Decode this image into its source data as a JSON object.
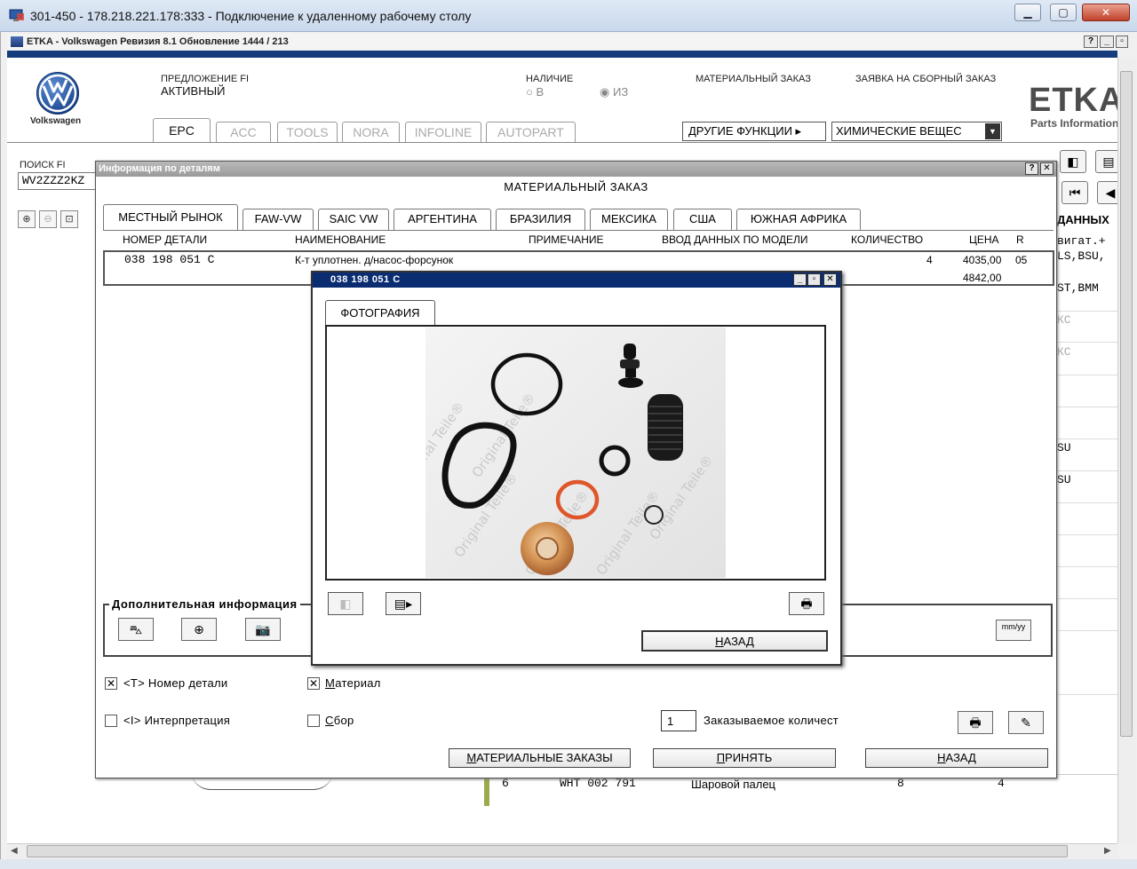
{
  "rdp": {
    "title": "301-450 - 178.218.221.178:333 - Подключение к удаленному рабочему столу"
  },
  "app": {
    "title": "ETKA - Volkswagen Ревизия 8.1 Обновление 1444 / 213",
    "brand_logo_label": "Volkswagen",
    "brand_name": "ETKA",
    "brand_subtitle": "Parts Information"
  },
  "header": {
    "offer_label": "ПРЕДЛОЖЕНИЕ FI",
    "offer_status": "АКТИВНЫЙ",
    "availability_label": "НАЛИЧИЕ",
    "radio_in": "В",
    "radio_from": "ИЗ",
    "material_order_link": "МАТЕРИАЛЬНЫЙ ЗАКАЗ",
    "collective_order_link": "ЗАЯВКА НА СБОРНЫЙ ЗАКАЗ",
    "other_functions": "ДРУГИЕ ФУНКЦИИ",
    "chem_select": "ХИМИЧЕСКИЕ ВЕЩЕС"
  },
  "app_tabs": [
    "EPC",
    "ACC",
    "TOOLS",
    "NORA",
    "INFOLINE",
    "AUTOPART"
  ],
  "search": {
    "label": "ПОИСК FI",
    "value": "WV2ZZZ2KZ"
  },
  "right_column": {
    "header": "ДАННЫХ",
    "rows": [
      "вигат.+",
      "LS,BSU,",
      "ST,BMM",
      "КС",
      "КС",
      "SU",
      "SU"
    ]
  },
  "background_row": {
    "pos": "6",
    "part": "WHT 002 791",
    "name": "Шаровой палец",
    "c1": "8",
    "c2": "4"
  },
  "dialog_info": {
    "title": "Информация по деталям",
    "heading": "МАТЕРИАЛЬНЫЙ ЗАКАЗ",
    "market_tabs": [
      "МЕСТНЫЙ РЫНОК",
      "FAW-VW",
      "SAIC VW",
      "АРГЕНТИНА",
      "БРАЗИЛИЯ",
      "МЕКСИКА",
      "США",
      "ЮЖНАЯ АФРИКА"
    ],
    "columns": {
      "part_number": "НОМЕР ДЕТАЛИ",
      "name": "НАИМЕНОВАНИЕ",
      "note": "ПРИМЕЧАНИЕ",
      "model_input": "ВВОД ДАННЫХ ПО МОДЕЛИ",
      "quantity": "КОЛИЧЕСТВО",
      "price": "ЦЕНА",
      "r": "R"
    },
    "row": {
      "part_number": "038 198 051 C",
      "name": "К-т уплотнен. д/насос-форсунок",
      "quantity": "4",
      "price": "4035,00",
      "price2": "4842,00",
      "r": "05"
    },
    "additional_info_label": "Дополнительная информация",
    "checkboxes": {
      "part_number": {
        "label": "<T> Номер детали",
        "checked": true
      },
      "interpretation": {
        "label": "<I> Интерпретация",
        "checked": false
      },
      "material": {
        "label": "Материал",
        "checked": true
      },
      "assembly": {
        "label": "Сбор",
        "checked": false
      }
    },
    "order_qty_value": "1",
    "order_qty_label": "Заказываемое количест",
    "date_button": "mm/yy",
    "buttons": {
      "material_orders": "МАТЕРИАЛЬНЫЕ ЗАКАЗЫ",
      "accept": "ПРИНЯТЬ",
      "back": "НАЗАД"
    }
  },
  "dialog_photo": {
    "title": "038 198 051 C",
    "tab": "ФОТОГРАФИЯ",
    "back_button": "НАЗАД",
    "watermark": "Original Teile®"
  },
  "colors": {
    "vw_blue": "#1a4f9c",
    "title_blue": "#0a2d72",
    "strip_blue": "#153d7e",
    "accent_green": "#9aab4d",
    "oring_orange": "#e0562b"
  }
}
